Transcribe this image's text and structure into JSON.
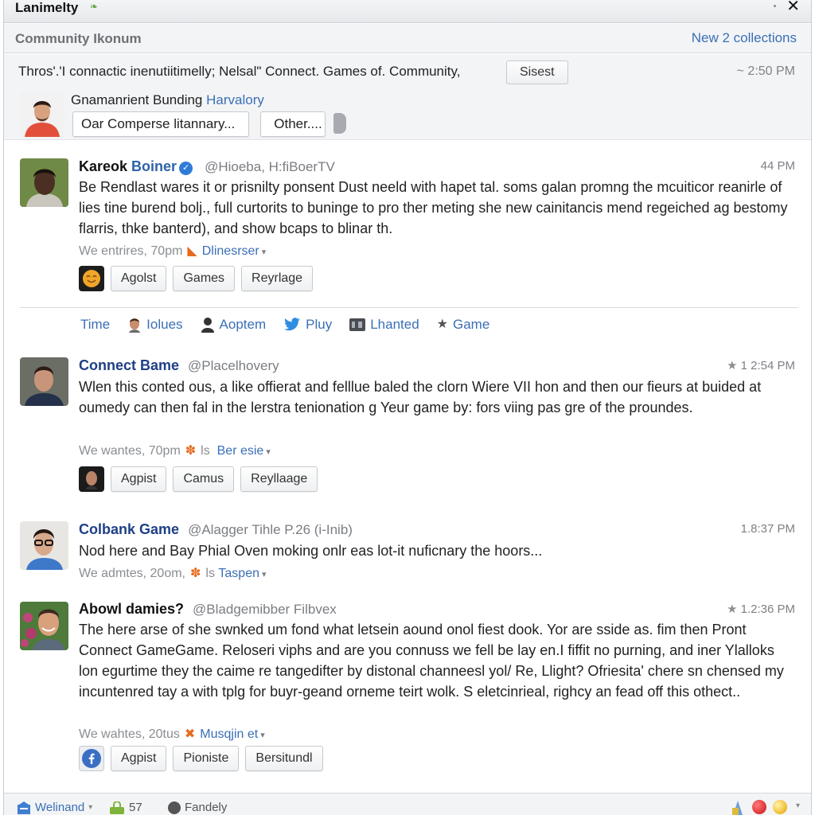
{
  "window": {
    "title": "Lanimelty",
    "close_label": "✕"
  },
  "subheader": {
    "title": "Community Ikonum",
    "new_link": "New 2 collections"
  },
  "composer": {
    "line": "Thros'.'I connactic inenutiitimelly; Nelsal\" Connect. Games of. Community,",
    "suggest_button": "Sisest",
    "time": "~ 2:50 PM",
    "label": "Gnamanrient Bunding",
    "label_link": "Harvalory",
    "field_value": "Oar Comperse litannary...",
    "other_button": "Other...."
  },
  "posts": [
    {
      "author_first": "Kareok",
      "author_last": "Boiner",
      "verified": true,
      "handle": "@Hioeba, H:fiBoerTV",
      "time": "44 PM",
      "body": "Be Rendlast wares it or prisnilty ponsent Dust neeld with hapet tal. soms galan promng the mcuiticor reanirle of lies tine burend bolj., full curtorits to buninge to pro ther meting she new cainitancis mend regeiched ag bestomy flarris, thke banterd), and show bcaps to blinar th.",
      "meta_text": "We entrires, 70pm",
      "meta_link": "Dlinesrser",
      "actions": [
        "Agolst",
        "Games",
        "Reyrlage"
      ]
    },
    {
      "author": "Connect Bame",
      "handle": "@Placelhovery",
      "time": "1 2:54 PM",
      "starred": true,
      "body": "Wlen this conted ous, a like offierat and felllue baled the clorn Wiere VII hon and then our fieurs at buided at oumedy can then fal in the lerstra tenionation g Yeur game by: fors viing pas gre of the proundes.",
      "meta_text": "We wantes, 70pm",
      "meta_extra": "ls",
      "meta_link": "Ber esie",
      "actions": [
        "Agpist",
        "Camus",
        "Reyllaage"
      ]
    },
    {
      "author": "Colbank Game",
      "handle": "@Alagger Tihle P.26 (i-Inib)",
      "time": "1.8:37 PM",
      "body": "Nod here and Bay Phial Oven moking onlr eas lot-it nuficnary the hoors...",
      "meta_text": "We admtes, 20om,",
      "meta_extra": "ls",
      "meta_link": "Taspen"
    },
    {
      "author": "Abowl damies?",
      "handle": "@Bladgemibber Filbvex",
      "time": "1.2:36 PM",
      "starred": true,
      "body": "The here arse of she swnked um fond what letsein aound onol fiest dook. Yor are sside as. fim then Pront Connect GameGame. Reloseri viphs and are you connuss we fell be lay en.I fiffit no purning, and iner Ylalloks lon egurtime they the caime re tangedifter by distonal channeesl yol/ Re, Llight? Ofriesita' chere sn chensed my incuntenred tay a with tplg for buyr-geand orneme teirt wolk. S eletcinrieal, righcy an fead off this othect..",
      "meta_text": "We wahtes, 20tus",
      "meta_link": "Musqjin et",
      "actions": [
        "Agpist",
        "Pioniste",
        "Bersitundl"
      ]
    }
  ],
  "tabs": [
    {
      "label": "Time",
      "icon": "none"
    },
    {
      "label": "Iolues",
      "icon": "person-photo-icon"
    },
    {
      "label": "Aoptem",
      "icon": "user-silhouette-icon"
    },
    {
      "label": "Pluy",
      "icon": "twitter-bird-icon"
    },
    {
      "label": "Lhanted",
      "icon": "gallery-icon"
    },
    {
      "label": "Game",
      "icon": "star-icon"
    }
  ],
  "footer": {
    "left_label": "Welinand",
    "count": "57",
    "status_label": "Fandely"
  },
  "colors": {
    "accent_link": "#3b6fb6",
    "verified": "#2f7bd8",
    "status_red": "#e03a3a",
    "status_yellow": "#f2c23a"
  }
}
